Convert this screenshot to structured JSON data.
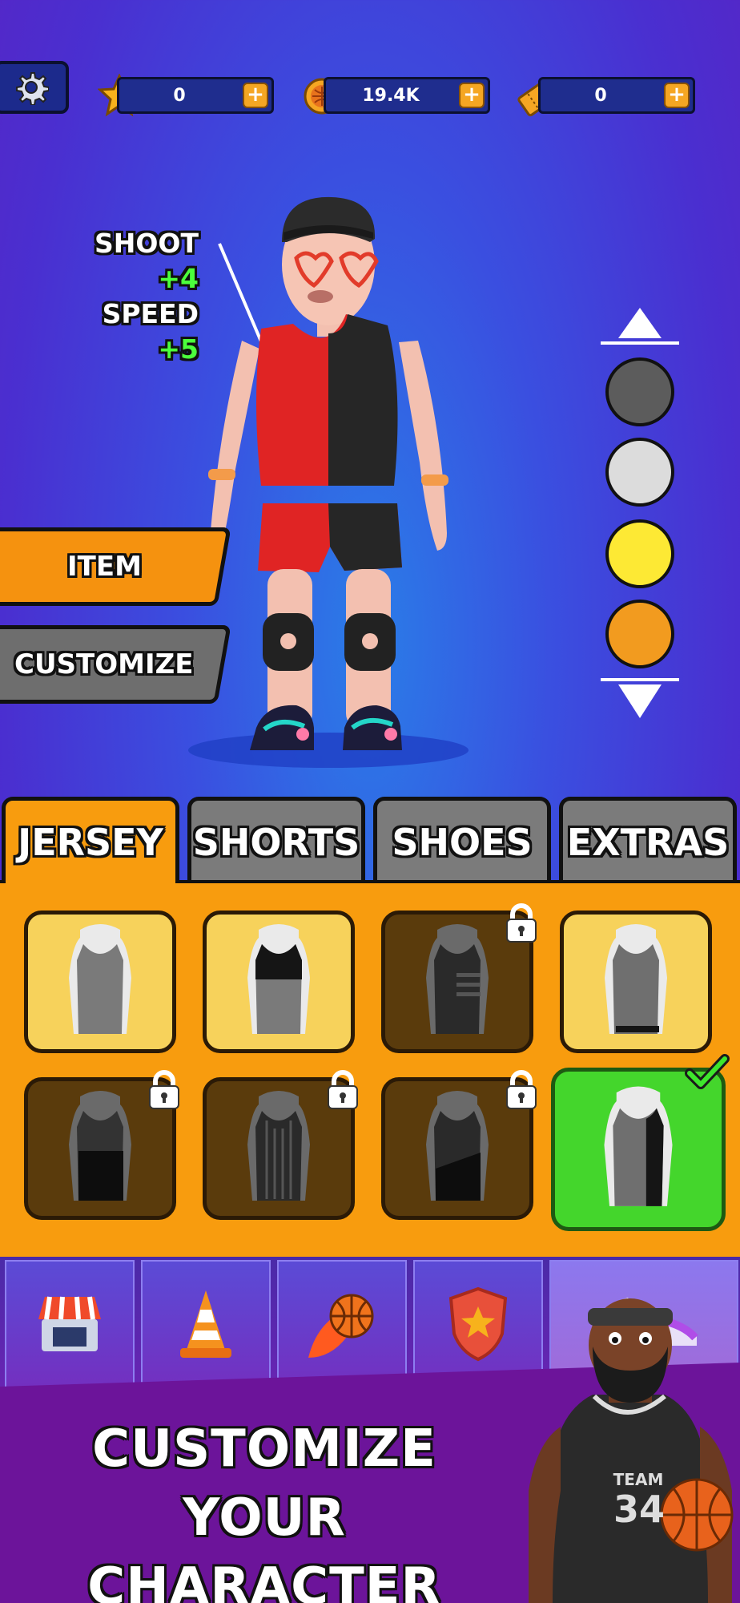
{
  "topbar": {
    "stars": "0",
    "coins": "19.4K",
    "tickets": "0",
    "plus": "+"
  },
  "stats": {
    "shoot_label": "SHOOT",
    "shoot_value": "+4",
    "speed_label": "SPEED",
    "speed_value": "+5"
  },
  "side_buttons": {
    "item": "ITEM",
    "customize": "CUSTOMIZE"
  },
  "color_options": [
    "#5c5c5c",
    "#dcdcdc",
    "#fde934",
    "#f29b1f"
  ],
  "tabs": [
    "JERSEY",
    "SHORTS",
    "SHOES",
    "EXTRAS"
  ],
  "active_tab": "JERSEY",
  "nav_icons": [
    "shop-icon",
    "cone-icon",
    "fireball-icon",
    "badge-icon",
    "sneaker-icon"
  ],
  "promo": {
    "line1": "CUSTOMIZE",
    "line2": "YOUR CHARACTER"
  },
  "mascot_jersey": {
    "team": "TEAM",
    "number": "34"
  }
}
